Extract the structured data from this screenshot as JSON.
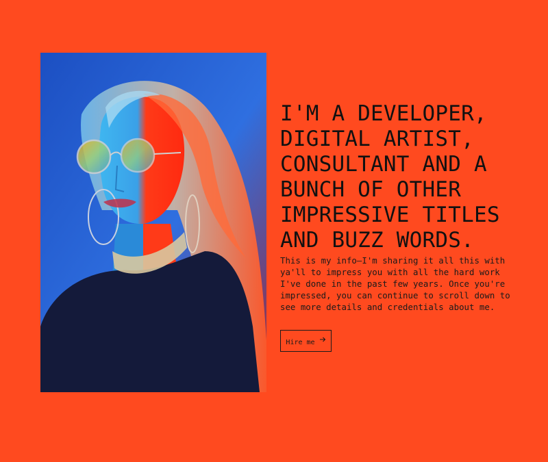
{
  "hero": {
    "headline": "I'M A DEVELOPER, DIGITAL ARTIST, CONSULTANT AND A BUNCH OF OTHER IMPRESSIVE TITLES AND BUZZ WORDS.",
    "intro": "This is my info—I'm sharing it all this with ya'll to impress you with all the hard work I've done in the past few years. Once you're impressed, you can continue to scroll down to see more details and credentials about me.",
    "cta_label": "Hire me",
    "cta_icon": "arrow-right-icon"
  },
  "portrait": {
    "subject": "portrait-photo"
  },
  "colors": {
    "background": "#ff4a1f",
    "text": "#111111",
    "photo_blue": "#1f4fc0",
    "photo_red": "#ff2a10"
  }
}
